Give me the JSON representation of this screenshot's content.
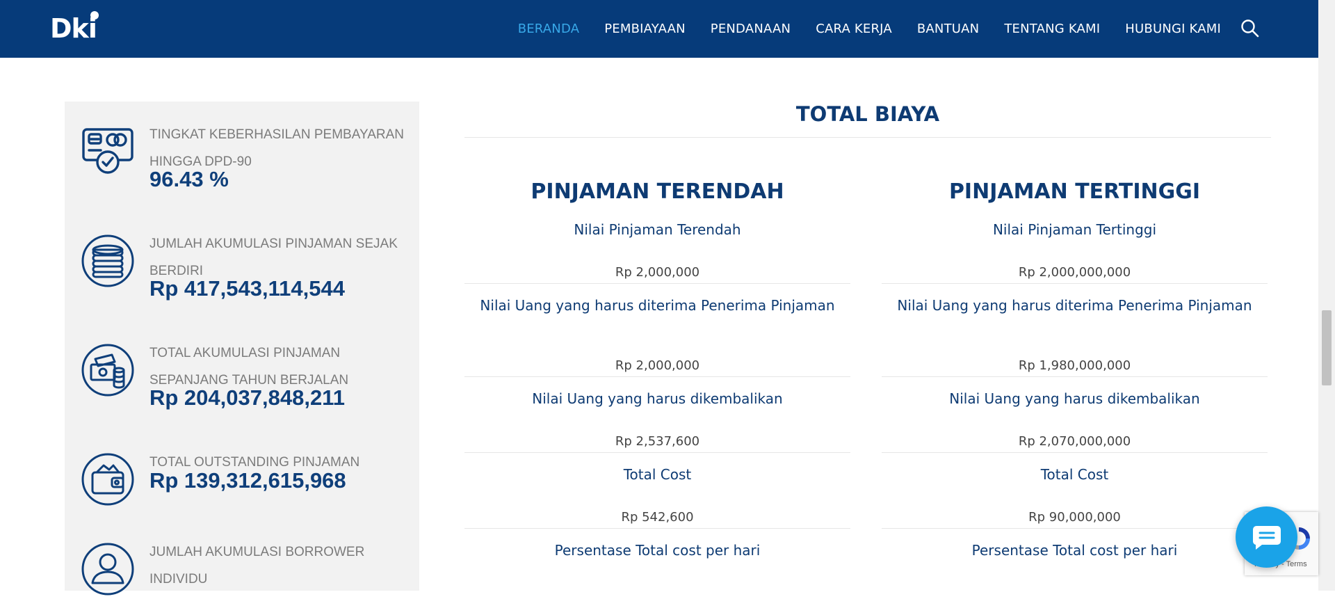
{
  "brand": {
    "logo_text": "Dki"
  },
  "nav": {
    "items": [
      "BERANDA",
      "PEMBIAYAAN",
      "PENDANAAN",
      "CARA KERJA",
      "BANTUAN",
      "TENTANG KAMI",
      "HUBUNGI KAMI"
    ],
    "active": "BERANDA",
    "search_icon": "search-icon"
  },
  "stats": [
    {
      "icon": "payment-success-icon",
      "label": "TINGKAT KEBERHASILAN PEMBAYARAN HINGGA DPD-90",
      "value": "96.43 %"
    },
    {
      "icon": "coins-icon",
      "label": "JUMLAH AKUMULASI PINJAMAN SEJAK BERDIRI",
      "value": "Rp 417,543,114,544"
    },
    {
      "icon": "money-stack-icon",
      "label": "TOTAL AKUMULASI PINJAMAN SEPANJANG TAHUN BERJALAN",
      "value": "Rp 204,037,848,211"
    },
    {
      "icon": "wallet-icon",
      "label": "TOTAL OUTSTANDING PINJAMAN",
      "value": "Rp 139,312,615,968"
    },
    {
      "icon": "user-icon",
      "label": "JUMLAH AKUMULASI BORROWER INDIVIDU",
      "value": ""
    }
  ],
  "total_biaya": {
    "title": "TOTAL BIAYA",
    "columns": [
      {
        "heading": "PINJAMAN TERENDAH",
        "rows": [
          {
            "label": "Nilai Pinjaman Terendah",
            "value": "Rp 2,000,000"
          },
          {
            "label": "Nilai Uang yang harus diterima Penerima Pinjaman",
            "value": "Rp 2,000,000"
          },
          {
            "label": "Nilai Uang yang harus dikembalikan",
            "value": "Rp 2,537,600"
          },
          {
            "label": "Total Cost",
            "value": "Rp 542,600"
          },
          {
            "label": "Persentase Total cost per hari",
            "value": ""
          }
        ]
      },
      {
        "heading": "PINJAMAN TERTINGGI",
        "rows": [
          {
            "label": "Nilai Pinjaman Tertinggi",
            "value": "Rp 2,000,000,000"
          },
          {
            "label": "Nilai Uang yang harus diterima Penerima Pinjaman",
            "value": "Rp 1,980,000,000"
          },
          {
            "label": "Nilai Uang yang harus dikembalikan",
            "value": "Rp 2,070,000,000"
          },
          {
            "label": "Total Cost",
            "value": "Rp 90,000,000"
          },
          {
            "label": "Persentase Total cost per hari",
            "value": ""
          }
        ]
      }
    ]
  },
  "chat_widget": {
    "icon": "chat-bubble-icon"
  },
  "recaptcha": {
    "links": "Privacy - Terms",
    "icon": "recaptcha-icon"
  },
  "colors": {
    "nav_bg": "#063b7a",
    "nav_active": "#38a8e8",
    "heading": "#0e3b73",
    "panel_bg": "#f2f2f2",
    "chat": "#1aa3e8"
  }
}
